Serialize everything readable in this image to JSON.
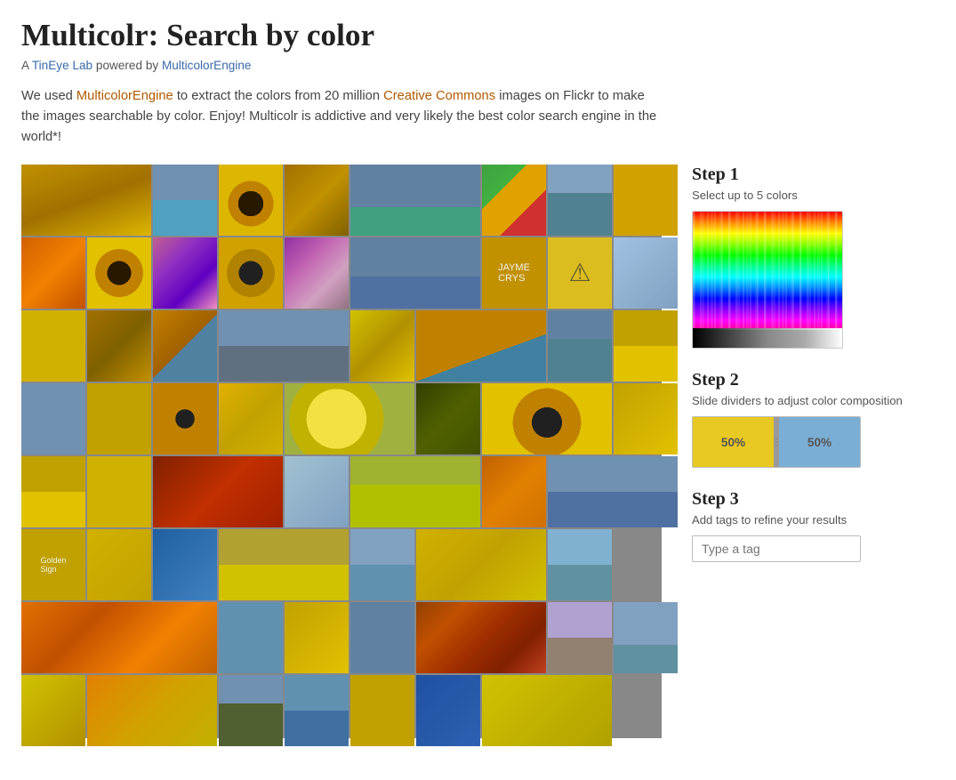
{
  "header": {
    "title": "Multicolr: Search by color",
    "subtitle_prefix": "A ",
    "subtitle_lab": "TinEye Lab",
    "subtitle_mid": " powered by ",
    "subtitle_engine": "MulticolorEngine",
    "description_parts": [
      "We used ",
      "MulticolorEngine",
      " to extract the colors from 20 million ",
      "Creative Commons",
      " images on Flickr to make the images searchable by color. Enjoy! Multicolr is addictive and very likely the best color search engine in the world*!"
    ]
  },
  "sidebar": {
    "step1": {
      "title": "Step 1",
      "description": "Select up to 5 colors"
    },
    "step2": {
      "title": "Step 2",
      "description": "Slide dividers to adjust color composition",
      "color1_pct": "50%",
      "color2_pct": "50%"
    },
    "step3": {
      "title": "Step 3",
      "description": "Add tags to refine your results",
      "tag_placeholder": "Type a tag"
    }
  },
  "colors": {
    "accent_yellow": "#e8c822",
    "accent_blue": "#7baed4"
  }
}
